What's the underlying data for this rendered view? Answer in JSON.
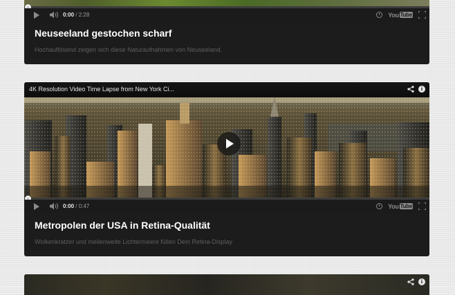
{
  "videos": [
    {
      "heading": "Neuseeland gestochen scharf",
      "description": "Hochauflösend zeigen sich diese Naturaufnahmen von Neuseeland.",
      "time_current": "0:00",
      "time_total": "/ 2:28",
      "progress_fraction": 0,
      "youtube_label": "You",
      "youtube_tube": "Tube"
    },
    {
      "player_title": "4K Resolution Video Time Lapse from New York Ci...",
      "heading": "Metropolen der USA in Retina-Qualität",
      "description": "Wolkenkratzer und meilenweite Lichtermeere füllen Dein Retina-Display",
      "time_current": "0:00",
      "time_total": "/ 0:47",
      "progress_fraction": 0,
      "youtube_label": "You",
      "youtube_tube": "Tube"
    },
    {
      "player_title": ""
    }
  ],
  "icons": {
    "play": "play-icon",
    "volume": "volume-icon",
    "watch_later": "clock-icon",
    "fullscreen": "fullscreen-icon",
    "share": "share-icon",
    "info": "info-icon",
    "info_glyph": "i"
  },
  "colors": {
    "page_bg": "#e9e9e9",
    "card_bg": "#1c1c1c",
    "heading": "#ffffff",
    "description": "#5e5e5e"
  }
}
